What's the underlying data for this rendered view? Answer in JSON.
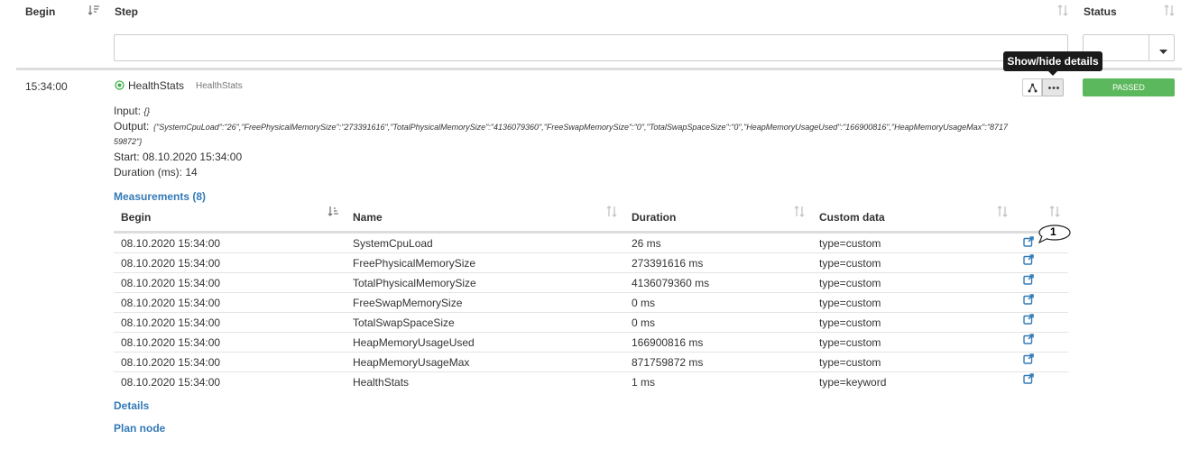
{
  "header": {
    "begin_label": "Begin",
    "step_label": "Step",
    "status_label": "Status"
  },
  "filters": {
    "step_value": "",
    "status_value": ""
  },
  "step_row": {
    "time": "15:34:00",
    "name": "HealthStats",
    "sub_name": "HealthStats",
    "status": "PASSED",
    "tooltip": "Show/hide details",
    "input_label": "Input:",
    "input_value": "{}",
    "output_label": "Output:",
    "output_line1": "{\"SystemCpuLoad\":\"26\",\"FreePhysicalMemorySize\":\"273391616\",\"TotalPhysicalMemorySize\":\"4136079360\",\"FreeSwapMemorySize\":\"0\",\"TotalSwapSpaceSize\":\"0\",\"HeapMemoryUsageUsed\":\"166900816\",\"HeapMemoryUsageMax\":\"8717",
    "output_line2": "59872\"}",
    "start_text": "Start: 08.10.2020 15:34:00",
    "duration_text": "Duration (ms): 14"
  },
  "measurements": {
    "title": "Measurements (8)",
    "columns": [
      "Begin",
      "Name",
      "Duration",
      "Custom data"
    ],
    "bubble": "1",
    "rows": [
      {
        "begin": "08.10.2020 15:34:00",
        "name": "SystemCpuLoad",
        "duration": "26 ms",
        "custom": "type=custom"
      },
      {
        "begin": "08.10.2020 15:34:00",
        "name": "FreePhysicalMemorySize",
        "duration": "273391616 ms",
        "custom": "type=custom"
      },
      {
        "begin": "08.10.2020 15:34:00",
        "name": "TotalPhysicalMemorySize",
        "duration": "4136079360 ms",
        "custom": "type=custom"
      },
      {
        "begin": "08.10.2020 15:34:00",
        "name": "FreeSwapMemorySize",
        "duration": "0 ms",
        "custom": "type=custom"
      },
      {
        "begin": "08.10.2020 15:34:00",
        "name": "TotalSwapSpaceSize",
        "duration": "0 ms",
        "custom": "type=custom"
      },
      {
        "begin": "08.10.2020 15:34:00",
        "name": "HeapMemoryUsageUsed",
        "duration": "166900816 ms",
        "custom": "type=custom"
      },
      {
        "begin": "08.10.2020 15:34:00",
        "name": "HeapMemoryUsageMax",
        "duration": "871759872 ms",
        "custom": "type=custom"
      },
      {
        "begin": "08.10.2020 15:34:00",
        "name": "HealthStats",
        "duration": "1 ms",
        "custom": "type=keyword"
      }
    ]
  },
  "links": {
    "details": "Details",
    "plan_node": "Plan node"
  },
  "colors": {
    "passed": "#5cb85c",
    "link": "#337ab7",
    "tooltip_bg": "#1a1a1a",
    "status_icon": "#3fae49"
  },
  "icons": {
    "sort": "sort-icon",
    "status": "check-circle-icon",
    "tree": "tree-icon",
    "more": "ellipsis-icon",
    "external": "external-link-icon",
    "dropdown": "caret-down-icon"
  }
}
